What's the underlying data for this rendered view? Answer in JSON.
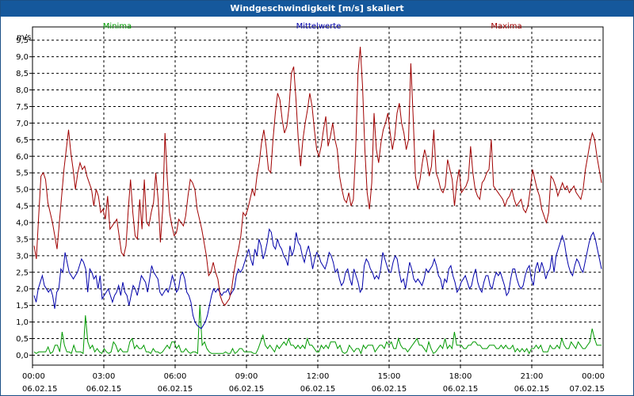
{
  "title": "Windgeschwindigkeit [m/s] skaliert",
  "colors": {
    "title_bg": "#15589c",
    "minima": "#009900",
    "mittel": "#0000aa",
    "maxima": "#a00000",
    "grid": "#000000"
  },
  "chart_data": {
    "type": "line",
    "title": "Windgeschwindigkeit [m/s] skaliert",
    "ylabel": "m/s",
    "ylim": [
      -0.3,
      9.9
    ],
    "yticks": [
      "0,0",
      "0,5",
      "1,0",
      "1,5",
      "2,0",
      "2,5",
      "3,0",
      "3,5",
      "4,0",
      "4,5",
      "5,0",
      "5,5",
      "6,0",
      "6,5",
      "7,0",
      "7,5",
      "8,0",
      "8,5",
      "9,0",
      "9,5"
    ],
    "xticks": [
      {
        "time": "00:00",
        "date": "06.02.15"
      },
      {
        "time": "03:00",
        "date": "06.02.15"
      },
      {
        "time": "06:00",
        "date": "06.02.15"
      },
      {
        "time": "09:00",
        "date": "06.02.15"
      },
      {
        "time": "12:00",
        "date": "06.02.15"
      },
      {
        "time": "15:00",
        "date": "06.02.15"
      },
      {
        "time": "18:00",
        "date": "06.02.15"
      },
      {
        "time": "21:00",
        "date": "06.02.15"
      },
      {
        "time": "00:00",
        "date": "07.02.15"
      }
    ],
    "grid": true,
    "legend": "top",
    "series": [
      {
        "name": "Minima",
        "color": "#009900",
        "values": [
          0.1,
          0.05,
          0.1,
          0.1,
          0.1,
          0.1,
          0.25,
          0.05,
          0.1,
          0.3,
          0.3,
          0.1,
          0.7,
          0.3,
          0.1,
          0.1,
          0.05,
          0.3,
          0.1,
          0.1,
          0.1,
          0.05,
          1.2,
          0.4,
          0.2,
          0.3,
          0.1,
          0.2,
          0.1,
          0.05,
          0.2,
          0.1,
          0.05,
          0.1,
          0.4,
          0.3,
          0.1,
          0.2,
          0.1,
          0.1,
          0.1,
          0.4,
          0.5,
          0.2,
          0.3,
          0.2,
          0.2,
          0.3,
          0.1,
          0.1,
          0.05,
          0.2,
          0.1,
          0.1,
          0.05,
          0.1,
          0.2,
          0.3,
          0.2,
          0.4,
          0.4,
          0.2,
          0.3,
          0.1,
          0.1,
          0.2,
          0.1,
          0.05,
          0.1,
          0.1,
          0.05,
          1.5,
          0.3,
          0.4,
          0.2,
          0.1,
          0.05,
          0.05,
          0.05,
          0.05,
          0.05,
          0.05,
          0.1,
          0.05,
          0.05,
          0.2,
          0.05,
          0.1,
          0.2,
          0.2,
          0.1,
          0.1,
          0.1,
          0.1,
          0.05,
          0.05,
          0.2,
          0.4,
          0.6,
          0.3,
          0.2,
          0.3,
          0.2,
          0.1,
          0.3,
          0.2,
          0.3,
          0.4,
          0.3,
          0.5,
          0.3,
          0.3,
          0.2,
          0.3,
          0.2,
          0.3,
          0.2,
          0.5,
          0.3,
          0.3,
          0.2,
          0.1,
          0.1,
          0.3,
          0.2,
          0.3,
          0.2,
          0.4,
          0.4,
          0.4,
          0.2,
          0.3,
          0.1,
          0.05,
          0.1,
          0.3,
          0.2,
          0.1,
          0.2,
          0.2,
          0.05,
          0.3,
          0.2,
          0.3,
          0.3,
          0.3,
          0.1,
          0.2,
          0.3,
          0.3,
          0.2,
          0.4,
          0.3,
          0.4,
          0.2,
          0.2,
          0.5,
          0.3,
          0.2,
          0.2,
          0.1,
          0.2,
          0.3,
          0.4,
          0.5,
          0.3,
          0.3,
          0.2,
          0.1,
          0.4,
          0.2,
          0.05,
          0.1,
          0.2,
          0.3,
          0.2,
          0.5,
          0.2,
          0.3,
          0.2,
          0.7,
          0.3,
          0.3,
          0.3,
          0.2,
          0.2,
          0.3,
          0.3,
          0.4,
          0.4,
          0.3,
          0.3,
          0.2,
          0.2,
          0.2,
          0.3,
          0.3,
          0.3,
          0.2,
          0.2,
          0.3,
          0.2,
          0.3,
          0.2,
          0.2,
          0.3,
          0.1,
          0.2,
          0.1,
          0.2,
          0.1,
          0.2,
          0.05,
          0.2,
          0.2,
          0.3,
          0.2,
          0.3,
          0.1,
          0.1,
          0.1,
          0.3,
          0.2,
          0.2,
          0.3,
          0.2,
          0.5,
          0.3,
          0.2,
          0.2,
          0.4,
          0.3,
          0.2,
          0.4,
          0.3,
          0.2,
          0.2,
          0.3,
          0.4,
          0.8,
          0.5,
          0.3,
          0.3,
          0.3
        ]
      },
      {
        "name": "Mittelwerte",
        "color": "#0000aa",
        "values": [
          1.8,
          1.6,
          2.0,
          2.2,
          2.4,
          2.1,
          2.0,
          1.9,
          2.0,
          1.8,
          1.4,
          1.9,
          2.0,
          2.6,
          2.5,
          3.1,
          2.8,
          2.5,
          2.4,
          2.3,
          2.4,
          2.5,
          2.7,
          2.9,
          2.8,
          2.6,
          1.9,
          2.6,
          2.5,
          2.3,
          2.4,
          2.0,
          2.4,
          1.7,
          1.8,
          1.9,
          2.0,
          1.8,
          1.6,
          1.8,
          1.9,
          2.1,
          1.8,
          2.2,
          1.9,
          1.8,
          1.5,
          1.8,
          2.1,
          2.0,
          1.8,
          2.1,
          2.4,
          2.3,
          2.2,
          1.9,
          2.3,
          2.7,
          2.5,
          2.4,
          2.3,
          1.9,
          1.8,
          1.9,
          2.0,
          1.9,
          2.1,
          2.4,
          2.2,
          1.9,
          2.0,
          2.4,
          2.5,
          2.3,
          1.9,
          1.8,
          1.6,
          1.2,
          1.0,
          0.9,
          0.85,
          0.8,
          0.9,
          1.0,
          1.2,
          1.5,
          1.8,
          2.0,
          1.9,
          2.0,
          1.9,
          1.8,
          1.9,
          1.9,
          2.0,
          1.8,
          1.9,
          2.0,
          2.4,
          2.6,
          2.5,
          2.6,
          2.8,
          3.0,
          3.2,
          2.9,
          2.7,
          3.2,
          3.0,
          3.5,
          3.3,
          2.9,
          3.1,
          3.4,
          3.8,
          3.7,
          3.3,
          3.2,
          3.5,
          3.3,
          3.2,
          3.0,
          2.9,
          2.7,
          3.3,
          3.0,
          3.2,
          3.7,
          3.4,
          3.3,
          3.0,
          2.8,
          3.1,
          3.3,
          3.0,
          2.6,
          2.9,
          3.1,
          3.0,
          2.8,
          2.7,
          2.6,
          2.8,
          3.1,
          3.0,
          2.8,
          2.5,
          2.6,
          2.3,
          2.1,
          2.2,
          2.5,
          2.6,
          2.3,
          2.1,
          2.6,
          2.4,
          2.2,
          1.9,
          2.0,
          2.7,
          2.9,
          2.8,
          2.6,
          2.5,
          2.3,
          2.4,
          2.3,
          2.6,
          3.1,
          2.9,
          2.7,
          2.5,
          2.5,
          2.8,
          3.0,
          2.9,
          2.5,
          2.2,
          2.3,
          2.0,
          2.4,
          2.8,
          2.6,
          2.3,
          2.2,
          2.3,
          2.2,
          2.1,
          2.3,
          2.6,
          2.5,
          2.6,
          2.7,
          2.9,
          2.7,
          2.4,
          2.3,
          2.0,
          2.3,
          2.2,
          2.6,
          2.7,
          2.4,
          2.2,
          1.9,
          2.0,
          2.2,
          2.3,
          2.4,
          2.2,
          2.0,
          2.1,
          2.4,
          2.6,
          2.2,
          2.0,
          1.9,
          2.2,
          2.4,
          2.4,
          2.1,
          2.0,
          2.3,
          2.5,
          2.4,
          2.5,
          2.3,
          2.1,
          1.8,
          1.9,
          2.3,
          2.6,
          2.6,
          2.3,
          2.1,
          2.0,
          2.1,
          2.4,
          2.6,
          2.7,
          2.3,
          2.1,
          2.6,
          2.8,
          2.5,
          2.8,
          2.6,
          2.3,
          2.5,
          2.6,
          3.0,
          2.5,
          3.0,
          3.2,
          3.4,
          3.6,
          3.4,
          3.0,
          2.7,
          2.5,
          2.4,
          2.7,
          2.9,
          2.8,
          2.6,
          2.5,
          2.8,
          3.1,
          3.4,
          3.6,
          3.7,
          3.5,
          3.2,
          2.9,
          2.6
        ]
      },
      {
        "name": "Maxima",
        "color": "#a00000",
        "values": [
          3.3,
          2.9,
          4.2,
          5.4,
          5.5,
          5.3,
          4.6,
          4.3,
          4.0,
          3.6,
          3.2,
          4.0,
          4.8,
          5.6,
          6.2,
          6.8,
          6.1,
          5.6,
          5.0,
          5.5,
          5.8,
          5.6,
          5.7,
          5.4,
          5.2,
          5.0,
          4.5,
          5.0,
          4.8,
          4.3,
          4.4,
          4.1,
          4.8,
          3.8,
          3.9,
          4.0,
          4.1,
          3.6,
          3.1,
          3.0,
          3.3,
          4.4,
          5.3,
          4.3,
          3.6,
          3.5,
          4.7,
          3.8,
          5.3,
          4.0,
          3.9,
          4.3,
          4.6,
          5.5,
          4.7,
          3.4,
          4.4,
          6.7,
          5.3,
          4.3,
          3.9,
          3.6,
          3.7,
          4.1,
          4.0,
          3.9,
          4.2,
          4.8,
          5.3,
          5.2,
          5.0,
          4.4,
          4.1,
          3.8,
          3.4,
          3.0,
          2.4,
          2.5,
          2.8,
          2.5,
          2.3,
          1.8,
          1.6,
          1.5,
          1.6,
          1.7,
          2.0,
          2.5,
          2.9,
          3.2,
          3.6,
          4.3,
          4.2,
          4.4,
          4.7,
          5.0,
          4.8,
          5.4,
          5.8,
          6.4,
          6.8,
          6.3,
          5.6,
          5.5,
          6.5,
          7.3,
          7.9,
          7.7,
          7.1,
          6.7,
          6.9,
          7.5,
          8.5,
          8.7,
          7.7,
          6.5,
          5.7,
          6.5,
          7.0,
          7.4,
          7.9,
          7.5,
          6.8,
          6.2,
          6.0,
          6.3,
          6.8,
          7.2,
          6.3,
          6.6,
          7.0,
          6.5,
          6.2,
          5.4,
          5.0,
          4.7,
          4.6,
          4.9,
          4.5,
          4.7,
          6.2,
          8.5,
          9.3,
          8.1,
          6.2,
          4.9,
          4.4,
          5.2,
          7.3,
          6.2,
          5.8,
          6.4,
          6.8,
          7.0,
          7.3,
          6.7,
          6.2,
          6.6,
          7.3,
          7.6,
          7.0,
          6.7,
          6.2,
          6.5,
          8.8,
          7.2,
          5.4,
          5.0,
          5.3,
          5.8,
          6.2,
          5.9,
          5.4,
          5.7,
          6.8,
          5.5,
          5.3,
          5.0,
          4.9,
          5.1,
          5.9,
          5.6,
          5.3,
          4.5,
          5.2,
          5.6,
          4.9,
          5.0,
          5.1,
          5.3,
          6.3,
          5.5,
          5.0,
          4.8,
          4.7,
          5.2,
          5.3,
          5.5,
          5.6,
          6.5,
          5.1,
          5.0,
          4.9,
          4.8,
          4.7,
          4.5,
          4.7,
          4.8,
          5.0,
          4.7,
          4.5,
          4.6,
          4.7,
          4.4,
          4.3,
          4.5,
          5.0,
          5.6,
          5.3,
          5.0,
          4.8,
          4.4,
          4.2,
          4.0,
          4.3,
          5.4,
          5.3,
          5.1,
          4.8,
          5.0,
          5.2,
          5.0,
          5.1,
          4.9,
          5.0,
          5.1,
          4.9,
          4.8,
          4.7,
          5.0,
          5.6,
          6.0,
          6.4,
          6.7,
          6.5,
          6.0,
          5.6,
          5.2
        ]
      }
    ]
  }
}
